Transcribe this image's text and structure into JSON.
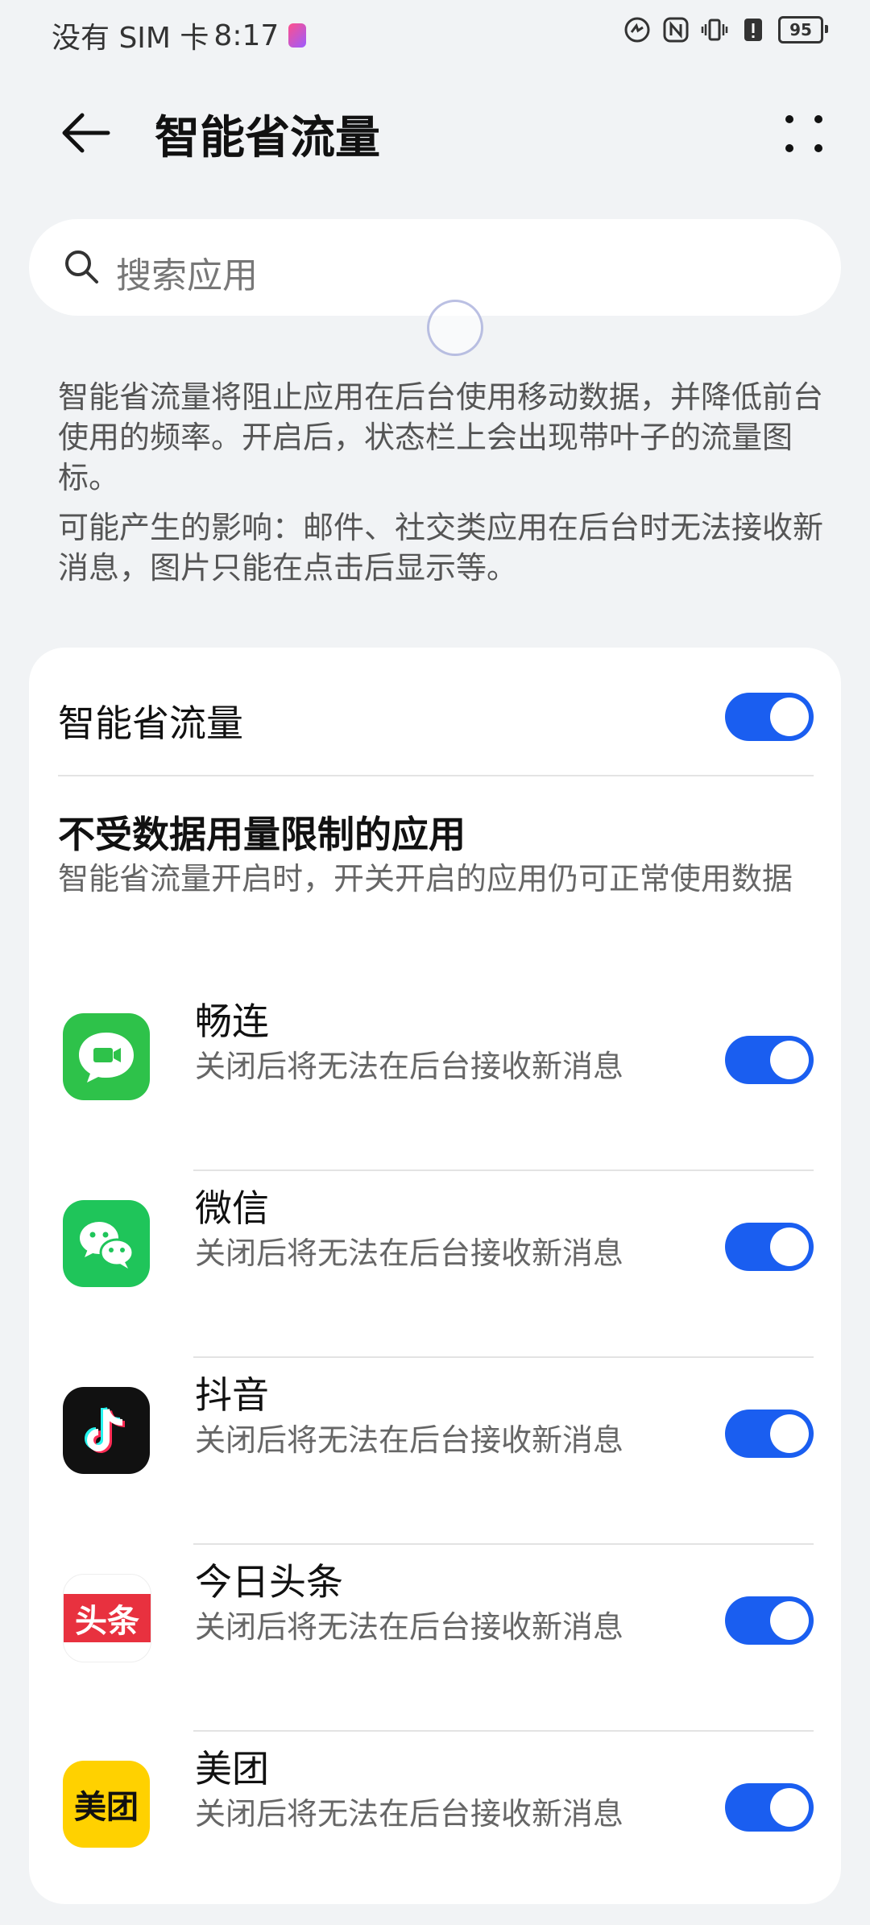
{
  "status": {
    "carrier": "没有 SIM 卡",
    "time": "8:17",
    "battery": "95"
  },
  "header": {
    "title": "智能省流量"
  },
  "search": {
    "placeholder": "搜索应用"
  },
  "description": {
    "p1": "智能省流量将阻止应用在后台使用移动数据，并降低前台使用的频率。开启后，状态栏上会出现带叶子的流量图标。",
    "p2": "可能产生的影响：邮件、社交类应用在后台时无法接收新消息，图片只能在点击后显示等。"
  },
  "main_toggle": {
    "label": "智能省流量",
    "on": true
  },
  "unrestricted": {
    "title": "不受数据用量限制的应用",
    "subtitle": "智能省流量开启时，开关开启的应用仍可正常使用数据"
  },
  "apps": [
    {
      "name": "畅连",
      "sub": "关闭后将无法在后台接收新消息",
      "on": true,
      "icon": "changlian-icon"
    },
    {
      "name": "微信",
      "sub": "关闭后将无法在后台接收新消息",
      "on": true,
      "icon": "wechat-icon"
    },
    {
      "name": "抖音",
      "sub": "关闭后将无法在后台接收新消息",
      "on": true,
      "icon": "douyin-icon"
    },
    {
      "name": "今日头条",
      "sub": "关闭后将无法在后台接收新消息",
      "on": true,
      "icon": "toutiao-icon",
      "icon_text": "头条"
    },
    {
      "name": "美团",
      "sub": "关闭后将无法在后台接收新消息",
      "on": true,
      "icon": "meituan-icon",
      "icon_text": "美团"
    }
  ],
  "colors": {
    "accent": "#1a5ef0",
    "background": "#f1f3f5"
  }
}
